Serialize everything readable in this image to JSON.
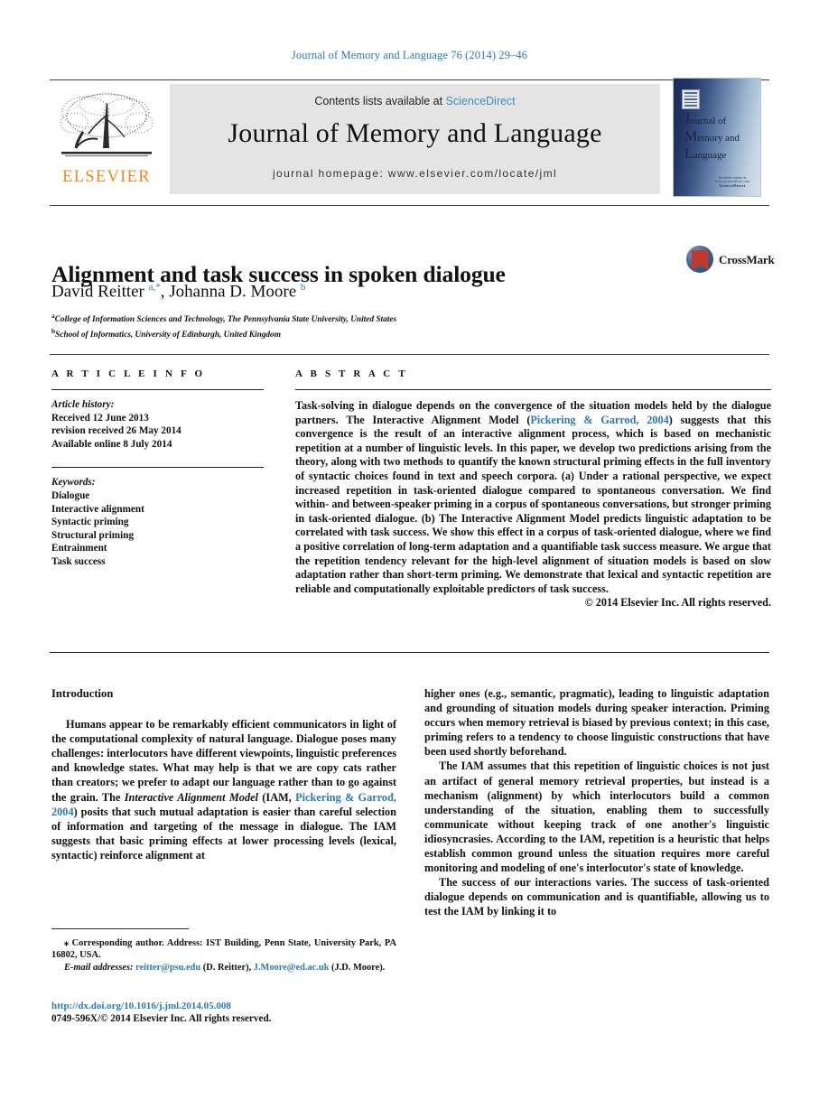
{
  "running_head": "Journal of Memory and Language 76 (2014) 29–46",
  "masthead": {
    "contents_prefix": "Contents lists available at ",
    "sciencedirect": "ScienceDirect",
    "journal_title": "Journal of Memory and Language",
    "homepage": "journal homepage: www.elsevier.com/locate/jml",
    "publisher_wordmark": "ELSEVIER"
  },
  "cover": {
    "line1_cap": "J",
    "line1_rest": "ournal of",
    "line2_cap": "M",
    "line2_rest": "emory and",
    "line3_cap": "L",
    "line3_rest": "anguage",
    "footer_line1": "Available online at www.sciencedirect.com",
    "footer_line2": "ScienceDirect"
  },
  "article": {
    "title": "Alignment and task success in spoken dialogue",
    "authors_html": "David Reitter <sup>a,*</sup>, Johanna D. Moore <sup>b</sup>",
    "affiliation_a": "College of Information Sciences and Technology, The Pennsylvania State University, United States",
    "affiliation_b": "School of Informatics, University of Edinburgh, United Kingdom",
    "crossmark_label": "CrossMark"
  },
  "info": {
    "heading": "A R T I C L E  I N F O",
    "history_label": "Article history:",
    "history_lines": [
      "Received 12 June 2013",
      "revision received 26 May 2014",
      "Available online 8 July 2014"
    ],
    "keywords_label": "Keywords:",
    "keywords": [
      "Dialogue",
      "Interactive alignment",
      "Syntactic priming",
      "Structural priming",
      "Entrainment",
      "Task success"
    ]
  },
  "abstract": {
    "heading": "A B S T R A C T",
    "part1": "Task-solving in dialogue depends on the convergence of the situation models held by the dialogue partners. The Interactive Alignment Model (",
    "citation": "Pickering & Garrod, 2004",
    "part2": ") suggests that this convergence is the result of an interactive alignment process, which is based on mechanistic repetition at a number of linguistic levels. In this paper, we develop two predictions arising from the theory, along with two methods to quantify the known structural priming effects in the full inventory of syntactic choices found in text and speech corpora. (a) Under a rational perspective, we expect increased repetition in task-oriented dialogue compared to spontaneous conversation. We find within- and between-speaker priming in a corpus of spontaneous conversations, but stronger priming in task-oriented dialogue. (b) The Interactive Alignment Model predicts linguistic adaptation to be correlated with task success. We show this effect in a corpus of task-oriented dialogue, where we find a positive correlation of long-term adaptation and a quantifiable task success measure. We argue that the repetition tendency relevant for the high-level alignment of situation models is based on slow adaptation rather than short-term priming. We demonstrate that lexical and syntactic repetition are reliable and computationally exploitable predictors of task success.",
    "copyright": "© 2014 Elsevier Inc. All rights reserved."
  },
  "body": {
    "intro_heading": "Introduction",
    "left_p1_a": "Humans appear to be remarkably efficient communicators in light of the computational complexity of natural language. Dialogue poses many challenges: interlocutors have different viewpoints, linguistic preferences and knowledge states. What may help is that we are copy cats rather than creators; we prefer to adapt our language rather than to go against the grain. The ",
    "left_p1_italic1": "Interactive Alignment Model",
    "left_p1_b": " (IAM, ",
    "left_p1_citation": "Pickering & Garrod, 2004",
    "left_p1_c": ") posits that such mutual adaptation is easier than careful selection of information and targeting of the message in dialogue. The IAM suggests that basic priming effects at lower processing levels (lexical, syntactic) reinforce alignment at",
    "right_p1": "higher ones (e.g., semantic, pragmatic), leading to linguistic adaptation and grounding of situation models during speaker interaction. Priming occurs when memory retrieval is biased by previous context; in this case, priming refers to a tendency to choose linguistic constructions that have been used shortly beforehand.",
    "right_p2": "The IAM assumes that this repetition of linguistic choices is not just an artifact of general memory retrieval properties, but instead is a mechanism (alignment) by which interlocutors build a common understanding of the situation, enabling them to successfully communicate without keeping track of one another's linguistic idiosyncrasies. According to the IAM, repetition is a heuristic that helps establish common ground unless the situation requires more careful monitoring and modeling of one's interlocutor's state of knowledge.",
    "right_p3": "The success of our interactions varies. The success of task-oriented dialogue depends on communication and is quantifiable, allowing us to test the IAM by linking it to"
  },
  "footnotes": {
    "corresponding": "Corresponding author. Address: IST Building, Penn State, University Park, PA 16802, USA.",
    "email_label": "E-mail addresses:",
    "email1": "reitter@psu.edu",
    "email1_owner": " (D. Reitter), ",
    "email2": "J.Moore@ed.ac.uk",
    "email2_owner": " (J.D. Moore).",
    "doi": "http://dx.doi.org/10.1016/j.jml.2014.05.008",
    "copyright_line": "0749-596X/© 2014 Elsevier Inc. All rights reserved."
  }
}
